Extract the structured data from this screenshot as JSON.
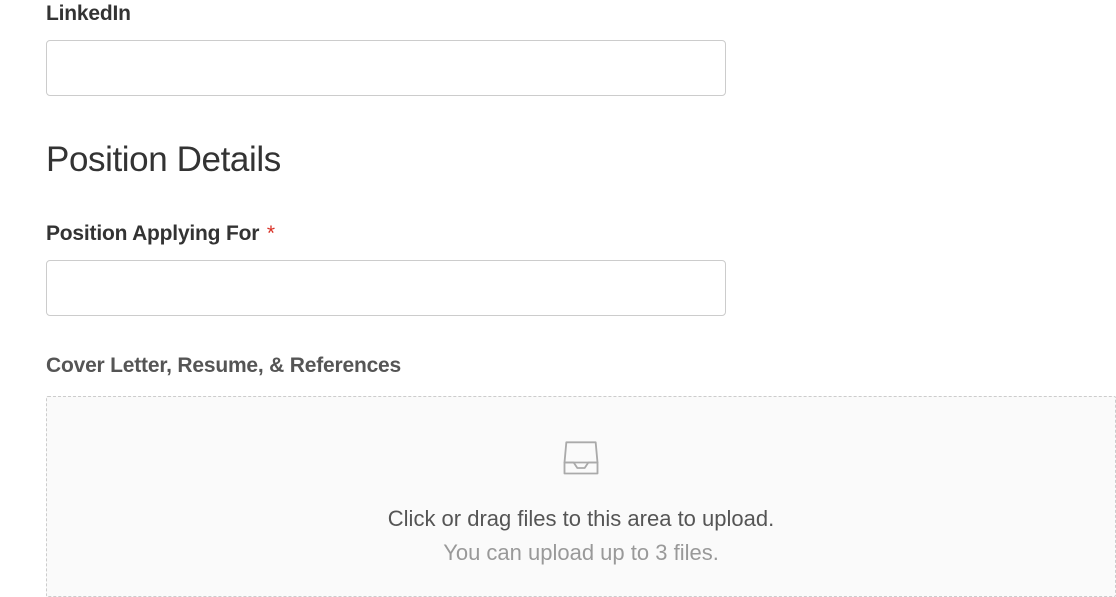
{
  "fields": {
    "linkedin": {
      "label": "LinkedIn",
      "value": ""
    },
    "position": {
      "label": "Position Applying For",
      "value": ""
    }
  },
  "section": {
    "heading": "Position Details"
  },
  "upload": {
    "label": "Cover Letter, Resume, & References",
    "primary": "Click or drag files to this area to upload.",
    "secondary": "You can upload up to 3 files."
  },
  "required_mark": "*"
}
